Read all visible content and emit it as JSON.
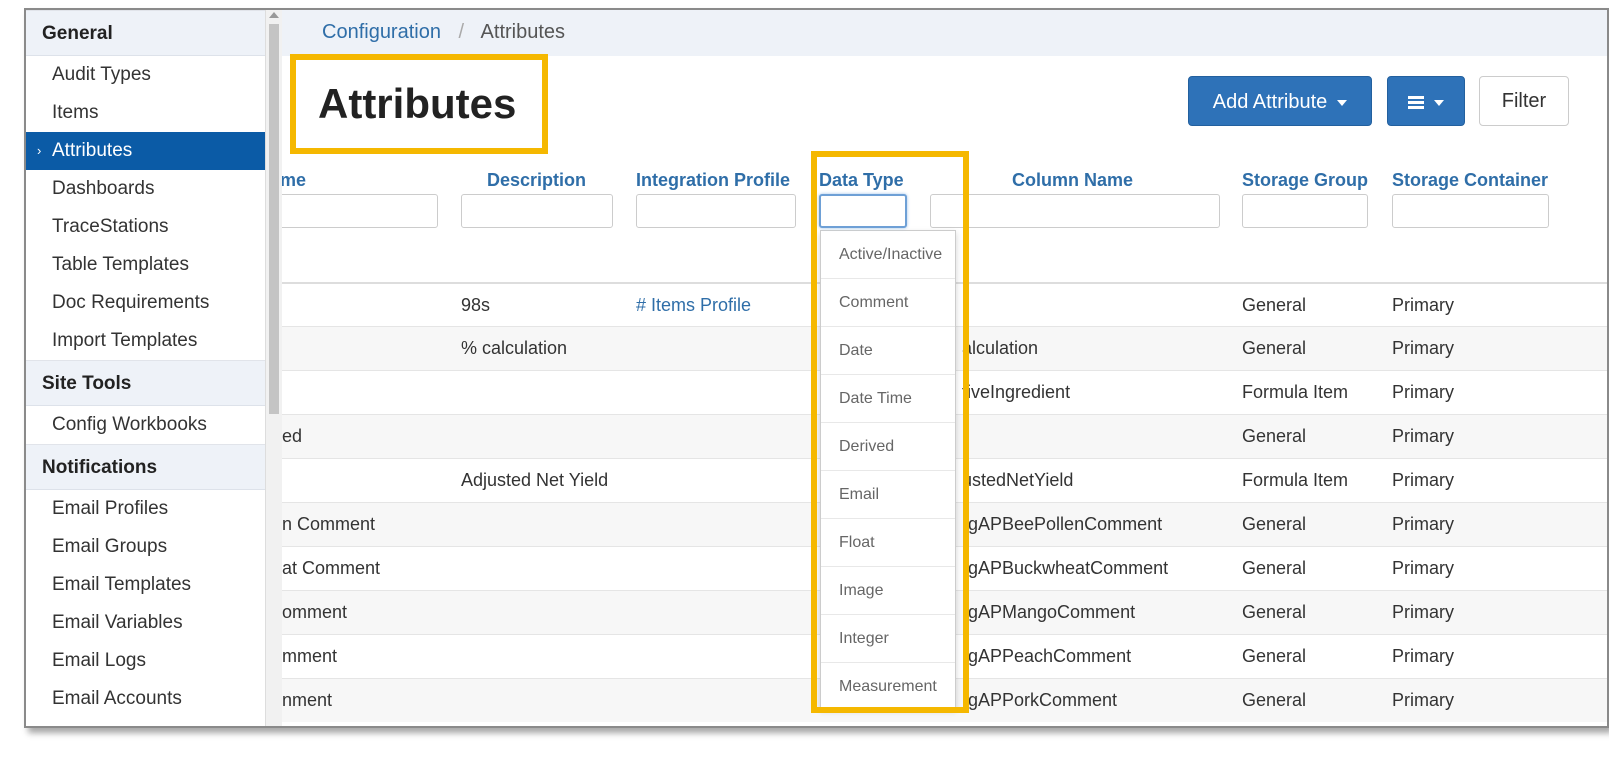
{
  "sidebar": {
    "sections": [
      {
        "header": "General",
        "items": [
          "Audit Types",
          "Items",
          "Attributes",
          "Dashboards",
          "TraceStations",
          "Table Templates",
          "Doc Requirements",
          "Import Templates"
        ]
      },
      {
        "header": "Site Tools",
        "items": [
          "Config Workbooks"
        ]
      },
      {
        "header": "Notifications",
        "items": [
          "Email Profiles",
          "Email Groups",
          "Email Templates",
          "Email Variables",
          "Email Logs",
          "Email Accounts"
        ]
      }
    ],
    "active_item": "Attributes"
  },
  "breadcrumb": {
    "parent": "Configuration",
    "separator": "/",
    "current": "Attributes"
  },
  "page": {
    "title": "Attributes"
  },
  "toolbar": {
    "add_label": "Add Attribute",
    "filter_label": "Filter"
  },
  "table": {
    "headers": {
      "name": "me",
      "description": "Description",
      "integration_profile": "Integration Profile",
      "data_type": "Data Type",
      "column_name": "Column Name",
      "storage_group": "Storage Group",
      "storage_container": "Storage Container"
    },
    "rows": [
      {
        "name": "",
        "description": "98s",
        "profile": "# Items Profile",
        "column": "",
        "group": "General",
        "container": "Primary"
      },
      {
        "name": "",
        "description": "% calculation",
        "profile": "",
        "column": "alculation",
        "group": "General",
        "container": "Primary"
      },
      {
        "name": "",
        "description": "",
        "profile": "",
        "column": "tiveIngredient",
        "group": "Formula Item",
        "container": "Primary"
      },
      {
        "name": "ed",
        "description": "",
        "profile": "",
        "column": "",
        "group": "General",
        "container": "Primary"
      },
      {
        "name": "",
        "description": "Adjusted Net Yield",
        "profile": "",
        "column": "ustedNetYield",
        "group": "Formula Item",
        "container": "Primary"
      },
      {
        "name": "n Comment",
        "description": "",
        "profile": "",
        "column": "rgAPBeePollenComment",
        "group": "General",
        "container": "Primary"
      },
      {
        "name": "at Comment",
        "description": "",
        "profile": "",
        "column": "rgAPBuckwheatComment",
        "group": "General",
        "container": "Primary"
      },
      {
        "name": "omment",
        "description": "",
        "profile": "",
        "column": "rgAPMangoComment",
        "group": "General",
        "container": "Primary"
      },
      {
        "name": "mment",
        "description": "",
        "profile": "",
        "column": "rgAPPeachComment",
        "group": "General",
        "container": "Primary"
      },
      {
        "name": "nment",
        "description": "",
        "profile": "",
        "column": "rgAPPorkComment",
        "group": "General",
        "container": "Primary"
      }
    ]
  },
  "data_type_dropdown": {
    "options": [
      "Active/Inactive",
      "Comment",
      "Date",
      "Date Time",
      "Derived",
      "Email",
      "Float",
      "Image",
      "Integer",
      "Measurement"
    ]
  },
  "colors": {
    "accent": "#2e72b8",
    "active_nav": "#0b5ba6",
    "highlight": "#f5b800",
    "link": "#2f6ea8"
  },
  "icons": {
    "active_chevron": "›",
    "menu": "hamburger-icon"
  }
}
